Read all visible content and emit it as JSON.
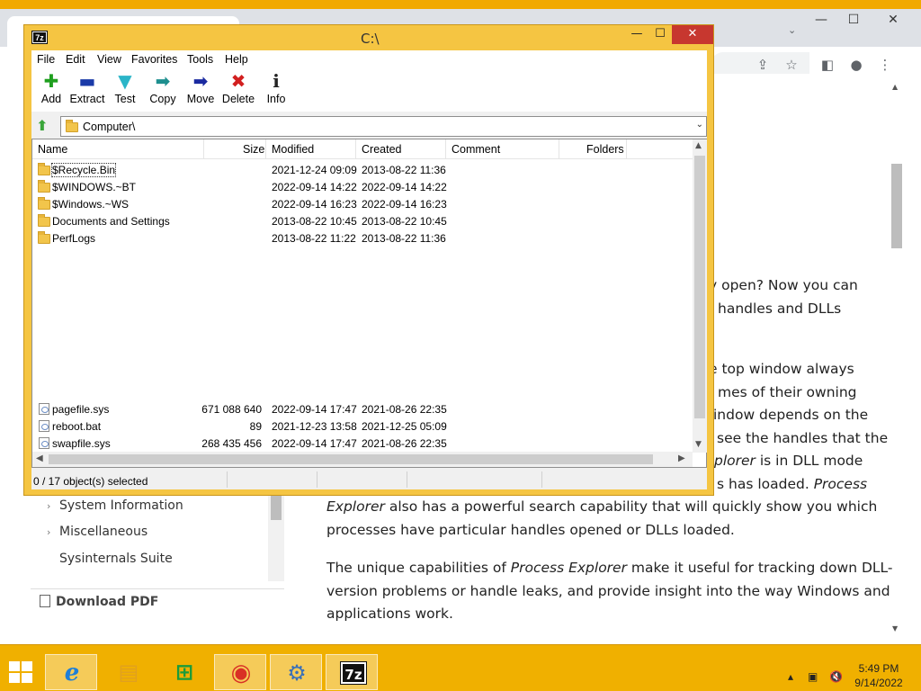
{
  "window": {
    "title": "C:\\",
    "app_icon_text": "7z",
    "controls": {
      "minimize": "—",
      "maximize": "☐",
      "close": "✕"
    }
  },
  "menu": [
    "File",
    "Edit",
    "View",
    "Favorites",
    "Tools",
    "Help"
  ],
  "toolbar": [
    {
      "label": "Add",
      "icon": "plus-icon",
      "glyph": "✚",
      "color": "#1f9f1f"
    },
    {
      "label": "Extract",
      "icon": "minus-icon",
      "glyph": "▬",
      "color": "#1a3aa8"
    },
    {
      "label": "Test",
      "icon": "check-chevron-icon",
      "glyph": "▼",
      "color": "#2bb5c8"
    },
    {
      "label": "Copy",
      "icon": "arrow-right-teal-icon",
      "glyph": "➡",
      "color": "#1e8f8f"
    },
    {
      "label": "Move",
      "icon": "arrow-right-blue-icon",
      "glyph": "➡",
      "color": "#1a2aa0"
    },
    {
      "label": "Delete",
      "icon": "delete-x-icon",
      "glyph": "✖",
      "color": "#d21f1f"
    },
    {
      "label": "Info",
      "icon": "info-icon",
      "glyph": "i",
      "color": "#222222"
    }
  ],
  "address": {
    "path": "Computer\\"
  },
  "columns": {
    "name": "Name",
    "size": "Size",
    "modified": "Modified",
    "created": "Created",
    "comment": "Comment",
    "folders": "Folders"
  },
  "folders": [
    {
      "name": "$Recycle.Bin",
      "size": "",
      "modified": "2021-12-24 09:09",
      "created": "2013-08-22 11:36"
    },
    {
      "name": "$WINDOWS.~BT",
      "size": "",
      "modified": "2022-09-14 14:22",
      "created": "2022-09-14 14:22"
    },
    {
      "name": "$Windows.~WS",
      "size": "",
      "modified": "2022-09-14 16:23",
      "created": "2022-09-14 16:23"
    },
    {
      "name": "Documents and Settings",
      "size": "",
      "modified": "2013-08-22 10:45",
      "created": "2013-08-22 10:45"
    },
    {
      "name": "PerfLogs",
      "size": "",
      "modified": "2013-08-22 11:22",
      "created": "2013-08-22 11:36"
    }
  ],
  "files": [
    {
      "name": "pagefile.sys",
      "size": "671 088 640",
      "modified": "2022-09-14 17:47",
      "created": "2021-08-26 22:35"
    },
    {
      "name": "reboot.bat",
      "size": "89",
      "modified": "2021-12-23 13:58",
      "created": "2021-12-25 05:09"
    },
    {
      "name": "swapfile.sys",
      "size": "268 435 456",
      "modified": "2022-09-14 17:47",
      "created": "2021-08-26 22:35"
    }
  ],
  "status": {
    "selection": "0 / 17 object(s) selected"
  },
  "browser_article": {
    "lines": [
      "y open? Now you can",
      "handles and DLLs",
      "e top window always",
      "mes of their owning",
      "indow depends on the",
      "see the handles that the"
    ],
    "line_dll_a": "plorer",
    "line_dll_b": " is in DLL mode",
    "line_loaded_a": "s has loaded. ",
    "line_loaded_b": "Process",
    "line_search_a": "Explorer",
    "line_search_b": " also has a powerful search capability that will quickly show you which",
    "line_handles": "processes have particular handles opened or DLLs loaded.",
    "p2_a": "The unique capabilities of ",
    "p2_b": "Process Explorer",
    "p2_c": " make it useful for tracking down DLL-",
    "p2_line2": "version problems or handle leaks, and provide insight into the way Windows and",
    "p2_line3": "applications work."
  },
  "sidebar": {
    "items": [
      "System Information",
      "Miscellaneous",
      "Sysinternals Suite"
    ],
    "download": "Download PDF"
  },
  "taskbar": {
    "apps": [
      {
        "name": "internet-explorer",
        "glyph": "e",
        "color": "#1e7fd8"
      },
      {
        "name": "file-explorer",
        "glyph": "▤",
        "color": "#e0a020"
      },
      {
        "name": "store",
        "glyph": "⊞",
        "color": "#1a9b3a"
      },
      {
        "name": "chrome",
        "glyph": "◉",
        "color": "#d93025"
      },
      {
        "name": "setup",
        "glyph": "⚙",
        "color": "#3a70b8"
      },
      {
        "name": "7zip",
        "glyph": "7z",
        "color": "#111111"
      }
    ],
    "time": "5:49 PM",
    "date": "9/14/2022"
  }
}
